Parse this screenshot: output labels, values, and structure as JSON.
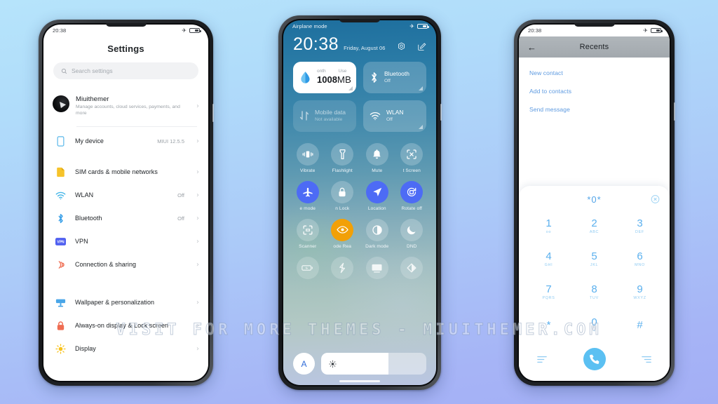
{
  "watermark": "VISIT FOR MORE THEMES - MIUITHEMER.COM",
  "colors": {
    "accent_blue": "#4d6bf5",
    "dialer_blue": "#5bb0ee",
    "call_green": "#5bc0f2",
    "orange": "#f2a007",
    "bg_top": "#b6e4fb",
    "bg_bottom": "#a3aef5"
  },
  "phone1": {
    "status": {
      "time": "20:38",
      "airplane_icon": "airplane-icon",
      "battery_icon": "battery-icon"
    },
    "title": "Settings",
    "search": {
      "placeholder": "Search settings",
      "icon": "search-icon"
    },
    "account": {
      "name": "Miuithemer",
      "subtitle": "Manage accounts, cloud services, payments, and more"
    },
    "device": {
      "label": "My device",
      "value": "MIUI 12.5.5",
      "icon": "phone-icon"
    },
    "items_group2": [
      {
        "label": "SIM cards & mobile networks",
        "value": "",
        "icon": "sim-icon"
      },
      {
        "label": "WLAN",
        "value": "Off",
        "icon": "wifi-icon"
      },
      {
        "label": "Bluetooth",
        "value": "Off",
        "icon": "bluetooth-icon"
      },
      {
        "label": "VPN",
        "value": "",
        "icon": "vpn-icon"
      },
      {
        "label": "Connection & sharing",
        "value": "",
        "icon": "sharing-icon"
      }
    ],
    "items_group3": [
      {
        "label": "Wallpaper & personalization",
        "value": "",
        "icon": "wallpaper-icon"
      },
      {
        "label": "Always-on display & Lock screen",
        "value": "",
        "icon": "lock-icon"
      },
      {
        "label": "Display",
        "value": "",
        "icon": "brightness-icon"
      }
    ],
    "chevron": "›"
  },
  "phone2": {
    "status": {
      "airplane_label": "Airplane mode",
      "airplane_icon": "airplane-icon",
      "battery_icon": "battery-icon"
    },
    "clock": {
      "time": "20:38",
      "date": "Friday, August 06"
    },
    "header_icons": [
      "settings-gear-icon",
      "edit-icon"
    ],
    "cards": [
      {
        "type": "data",
        "head_left": "onth",
        "head_right": "Use",
        "value": "1008",
        "unit": "MB",
        "icon": "data-drop-icon",
        "style": "light"
      },
      {
        "type": "toggle",
        "title": "Bluetooth",
        "subtitle": "Off",
        "icon": "bluetooth-icon",
        "style": "trans"
      },
      {
        "type": "toggle",
        "title": "Mobile data",
        "subtitle": "Not available",
        "icon": "mobile-data-icon",
        "style": "dim"
      },
      {
        "type": "toggle",
        "title": "WLAN",
        "subtitle": "Off",
        "icon": "wifi-icon",
        "style": "trans"
      }
    ],
    "toggles": [
      {
        "label": "Vibrate",
        "icon": "vibrate-icon",
        "state": "off"
      },
      {
        "label": "Flashlight",
        "icon": "flashlight-icon",
        "state": "off"
      },
      {
        "label": "Mute",
        "icon": "bell-icon",
        "state": "off"
      },
      {
        "label": "t  Screen",
        "icon": "screenshot-icon",
        "state": "off"
      },
      {
        "label": "e mode",
        "icon": "airplane-icon",
        "state": "on"
      },
      {
        "label": "n   Lock",
        "icon": "lock-icon",
        "state": "off"
      },
      {
        "label": "Location",
        "icon": "location-icon",
        "state": "on"
      },
      {
        "label": "Rotate off",
        "icon": "rotate-icon",
        "state": "on"
      },
      {
        "label": "Scanner",
        "icon": "scanner-icon",
        "state": "off"
      },
      {
        "label": "ode   Rea",
        "icon": "eye-icon",
        "state": "orange"
      },
      {
        "label": "Dark mode",
        "icon": "contrast-icon",
        "state": "off"
      },
      {
        "label": "DND",
        "icon": "moon-icon",
        "state": "off"
      },
      {
        "label": "",
        "icon": "battery-saver-icon",
        "state": "off"
      },
      {
        "label": "",
        "icon": "sync-icon",
        "state": "off"
      },
      {
        "label": "",
        "icon": "cast-icon",
        "state": "off"
      },
      {
        "label": "",
        "icon": "reading-mode-icon",
        "state": "off"
      }
    ],
    "brightness": {
      "auto_label": "A",
      "sun_icon": "sun-icon",
      "level": 64
    }
  },
  "phone3": {
    "status": {
      "time": "20:38",
      "airplane_icon": "airplane-icon",
      "battery_icon": "battery-icon"
    },
    "header": {
      "title": "Recents",
      "back_icon": "arrow-left-icon"
    },
    "menu": [
      "New contact",
      "Add to contacts",
      "Send message"
    ],
    "dialer": {
      "entry": "*0*",
      "backspace_icon": "backspace-circle-icon",
      "keys": [
        {
          "digit": "1",
          "letters": "oo"
        },
        {
          "digit": "2",
          "letters": "ABC"
        },
        {
          "digit": "3",
          "letters": "DEF"
        },
        {
          "digit": "4",
          "letters": "GHI"
        },
        {
          "digit": "5",
          "letters": "JKL"
        },
        {
          "digit": "6",
          "letters": "MNO"
        },
        {
          "digit": "7",
          "letters": "PQRS"
        },
        {
          "digit": "8",
          "letters": "TUV"
        },
        {
          "digit": "9",
          "letters": "WXYZ"
        },
        {
          "digit": "*",
          "letters": ""
        },
        {
          "digit": "0",
          "letters": "+"
        },
        {
          "digit": "#",
          "letters": ""
        }
      ],
      "actions": {
        "left_icon": "list-left-icon",
        "call_icon": "call-icon",
        "right_icon": "list-right-icon"
      }
    }
  }
}
